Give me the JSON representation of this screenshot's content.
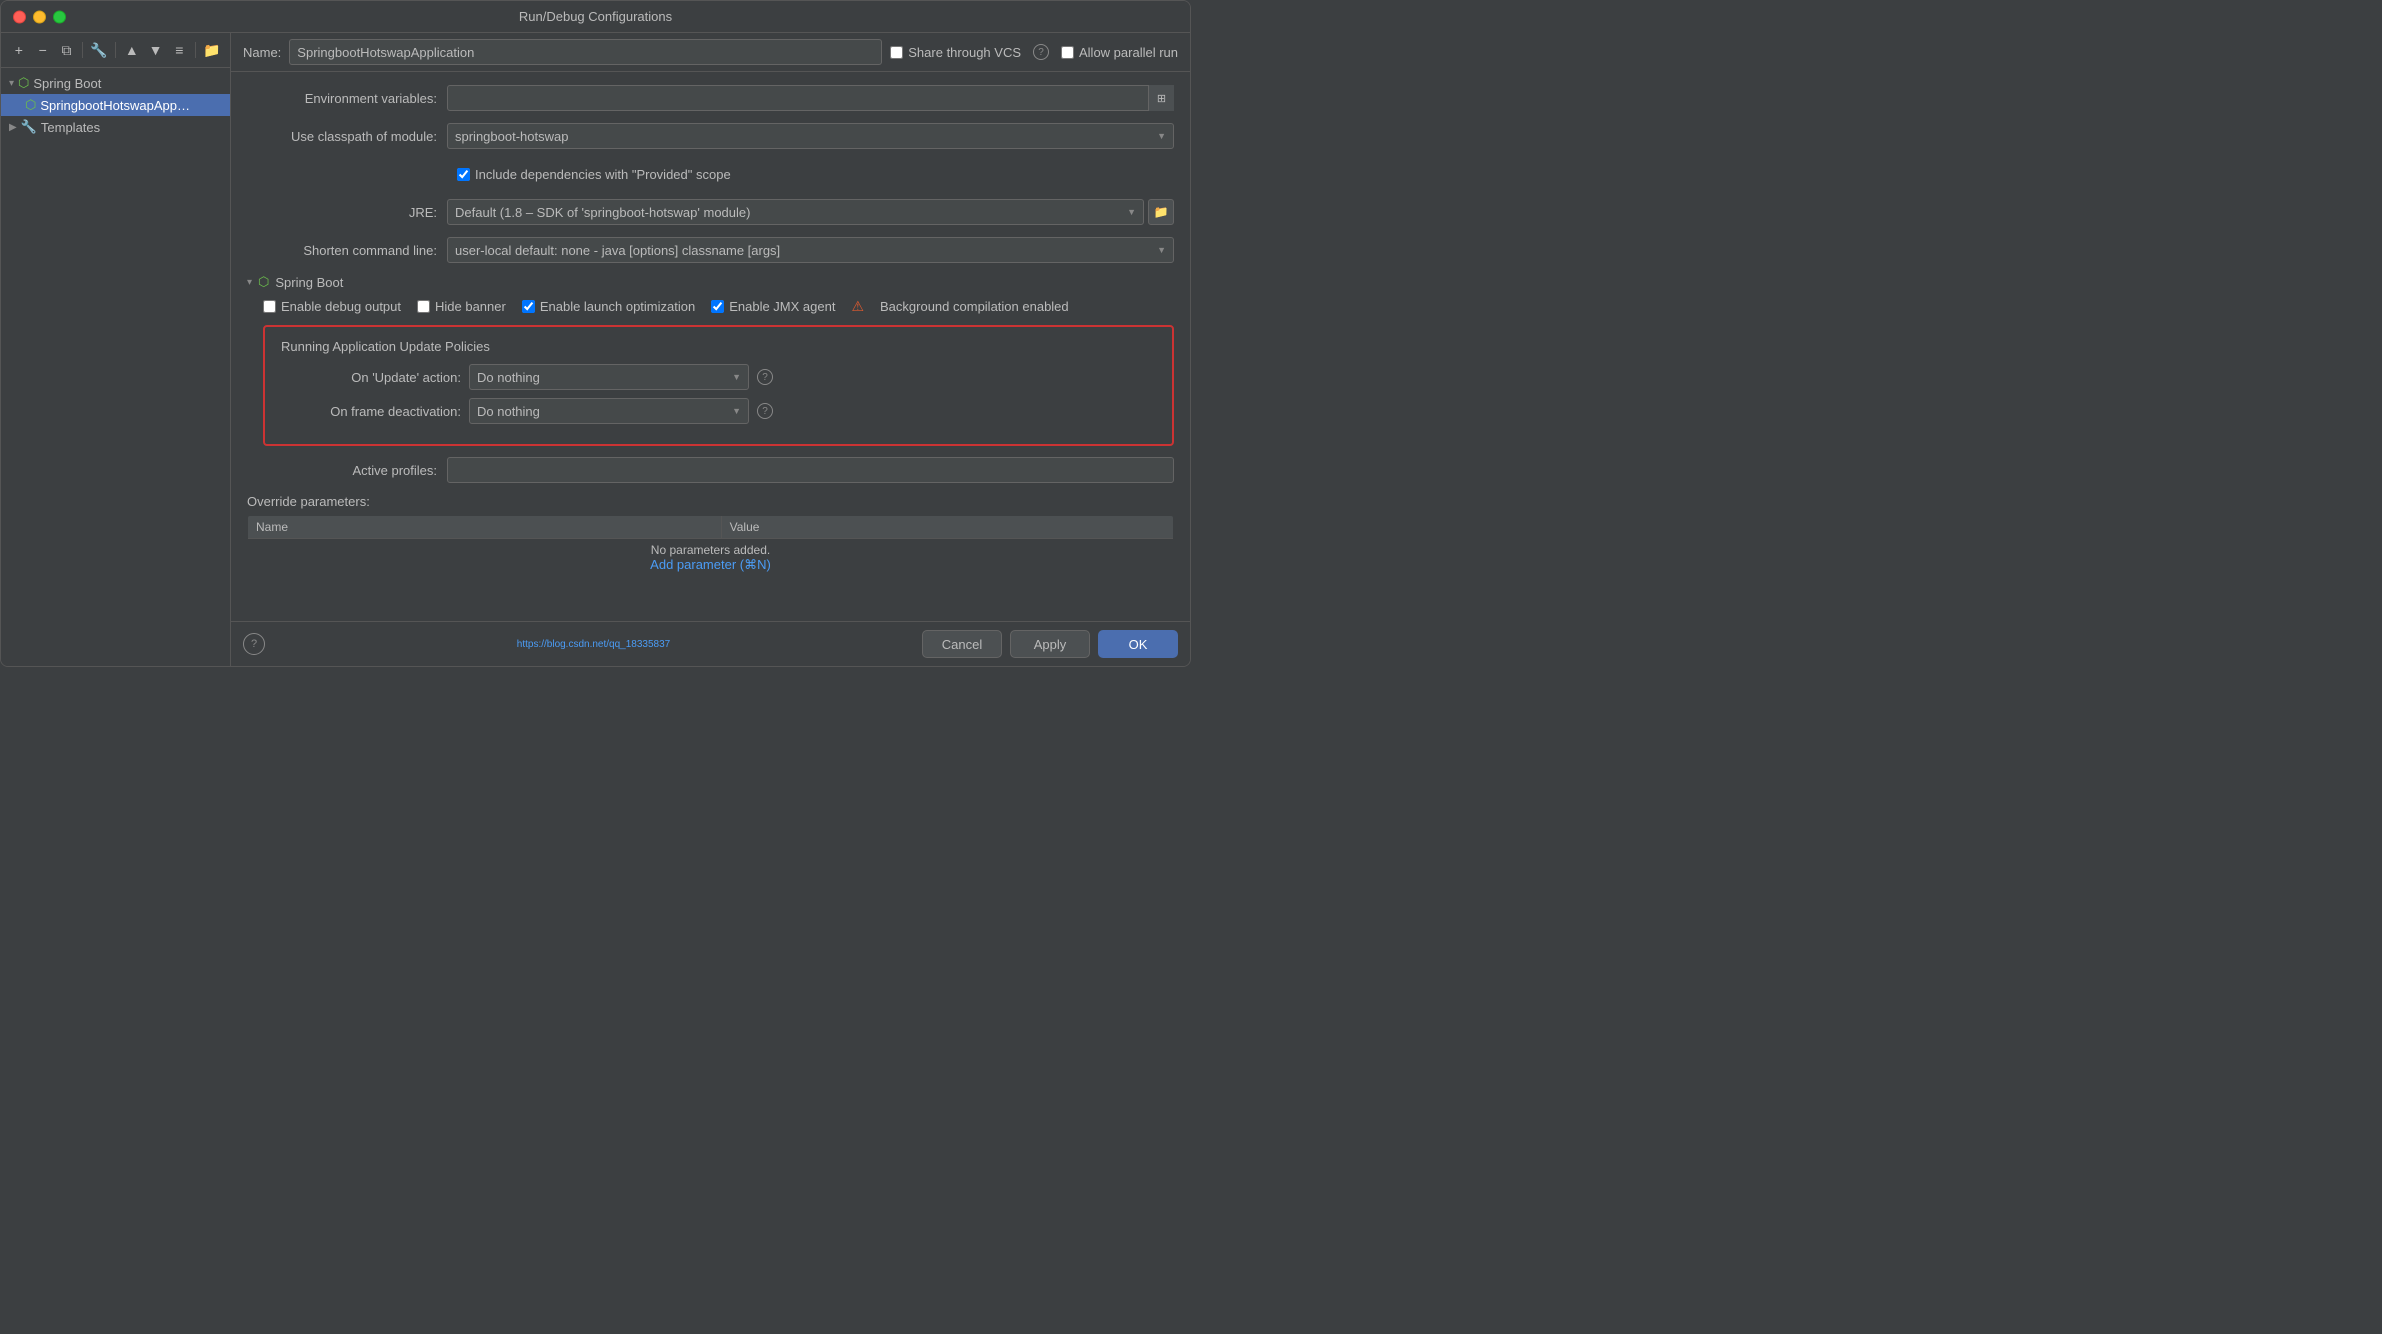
{
  "dialog": {
    "title": "Run/Debug Configurations"
  },
  "sidebar": {
    "toolbar_buttons": [
      "+",
      "−",
      "⧉",
      "🔧",
      "▲",
      "▼",
      "⋮",
      "⛳"
    ],
    "items": [
      {
        "id": "spring-boot",
        "label": "Spring Boot",
        "indent": 0,
        "expanded": true,
        "selected": false,
        "icon": "🌿"
      },
      {
        "id": "springboot-hotswap",
        "label": "SpringbootHotswapApp…",
        "indent": 1,
        "selected": true,
        "icon": "🌿"
      },
      {
        "id": "templates",
        "label": "Templates",
        "indent": 0,
        "expanded": false,
        "icon": ""
      }
    ]
  },
  "header": {
    "name_label": "Name:",
    "name_value": "SpringbootHotswapApplication",
    "share_label": "Share through VCS",
    "allow_parallel_label": "Allow parallel run"
  },
  "form": {
    "env_label": "Environment variables:",
    "env_value": "",
    "classpath_label": "Use classpath of module:",
    "classpath_value": "springboot-hotswap",
    "include_deps_label": "Include dependencies with \"Provided\" scope",
    "jre_label": "JRE:",
    "jre_value": "Default (1.8 – SDK of 'springboot-hotswap' module)",
    "shorten_label": "Shorten command line:",
    "shorten_value": "user-local default: none - java [options] classname [args]",
    "spring_boot_section": "Spring Boot",
    "enable_debug_label": "Enable debug output",
    "hide_banner_label": "Hide banner",
    "enable_launch_label": "Enable launch optimization",
    "enable_jmx_label": "Enable JMX agent",
    "bg_compilation_label": "Background compilation enabled",
    "policies_title": "Running Application Update Policies",
    "update_action_label": "On 'Update' action:",
    "update_action_value": "Do nothing",
    "frame_deact_label": "On frame deactivation:",
    "frame_deact_value": "Do nothing",
    "active_profiles_label": "Active profiles:",
    "active_profiles_value": "",
    "override_params_label": "Override parameters:",
    "table_name_col": "Name",
    "table_value_col": "Value",
    "no_params_text": "No parameters added.",
    "add_param_text": "Add parameter (⌘N)"
  },
  "footer": {
    "url": "https://blog.csdn.net/qq_18335837",
    "cancel_label": "Cancel",
    "apply_label": "Apply",
    "ok_label": "OK"
  }
}
